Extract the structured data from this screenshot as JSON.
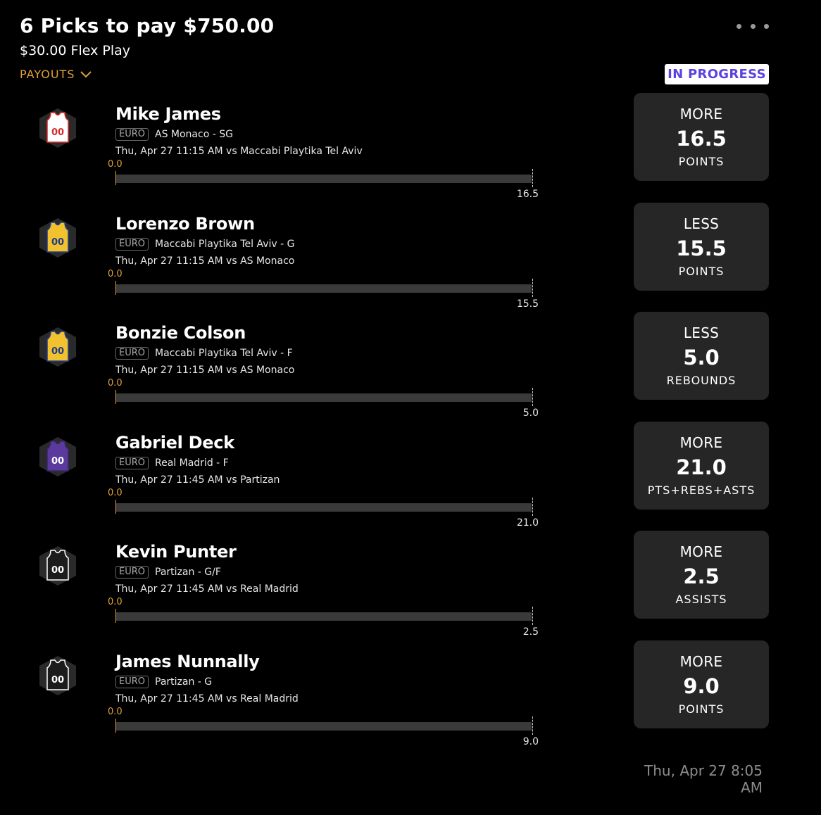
{
  "header": {
    "title": "6 Picks to pay $750.00",
    "subtitle": "$30.00 Flex Play",
    "payouts_label": "PAYOUTS",
    "status": "IN PROGRESS"
  },
  "colors": {
    "accent_orange": "#e3a03a",
    "status_purple": "#5b43e0",
    "card_bg": "#262626"
  },
  "picks": [
    {
      "name": "Mike James",
      "league": "EURO",
      "team_pos": "AS Monaco - SG",
      "game": "Thu, Apr 27 11:15 AM  vs Maccabi Playtika Tel Aviv",
      "current": "0.0",
      "line": "16.5",
      "progress": 0,
      "direction": "MORE",
      "stat": "POINTS",
      "jersey": {
        "icon": "jersey-icon",
        "body": "#ffffff",
        "trim": "#d62b2b",
        "number_color": "#d62b2b",
        "number": "00"
      }
    },
    {
      "name": "Lorenzo Brown",
      "league": "EURO",
      "team_pos": "Maccabi Playtika Tel Aviv - G",
      "game": "Thu, Apr 27 11:15 AM  vs AS Monaco",
      "current": "0.0",
      "line": "15.5",
      "progress": 0,
      "direction": "LESS",
      "stat": "POINTS",
      "jersey": {
        "icon": "jersey-icon",
        "body": "#f2c12e",
        "trim": "#1d3c8c",
        "number_color": "#1d3c8c",
        "number": "00"
      }
    },
    {
      "name": "Bonzie Colson",
      "league": "EURO",
      "team_pos": "Maccabi Playtika Tel Aviv - F",
      "game": "Thu, Apr 27 11:15 AM  vs AS Monaco",
      "current": "0.0",
      "line": "5.0",
      "progress": 0,
      "direction": "LESS",
      "stat": "REBOUNDS",
      "jersey": {
        "icon": "jersey-icon",
        "body": "#f2c12e",
        "trim": "#1d3c8c",
        "number_color": "#1d3c8c",
        "number": "00"
      }
    },
    {
      "name": "Gabriel Deck",
      "league": "EURO",
      "team_pos": "Real Madrid - F",
      "game": "Thu, Apr 27 11:45 AM  vs Partizan",
      "current": "0.0",
      "line": "21.0",
      "progress": 0,
      "direction": "MORE",
      "stat": "PTS+REBS+ASTS",
      "jersey": {
        "icon": "jersey-icon",
        "body": "#5a3a9c",
        "trim": "#3b2468",
        "number_color": "#ffffff",
        "number": "00"
      }
    },
    {
      "name": "Kevin Punter",
      "league": "EURO",
      "team_pos": "Partizan - G/F",
      "game": "Thu, Apr 27 11:45 AM  vs Real Madrid",
      "current": "0.0",
      "line": "2.5",
      "progress": 0,
      "direction": "MORE",
      "stat": "ASSISTS",
      "jersey": {
        "icon": "jersey-icon",
        "body": "#1c1c1c",
        "trim": "#ffffff",
        "number_color": "#ffffff",
        "number": "00"
      }
    },
    {
      "name": "James Nunnally",
      "league": "EURO",
      "team_pos": "Partizan - G",
      "game": "Thu, Apr 27 11:45 AM  vs Real Madrid",
      "current": "0.0",
      "line": "9.0",
      "progress": 0,
      "direction": "MORE",
      "stat": "POINTS",
      "jersey": {
        "icon": "jersey-icon",
        "body": "#1c1c1c",
        "trim": "#ffffff",
        "number_color": "#ffffff",
        "number": "00"
      }
    }
  ],
  "footer": {
    "timestamp": "Thu, Apr 27 8:05 AM"
  }
}
